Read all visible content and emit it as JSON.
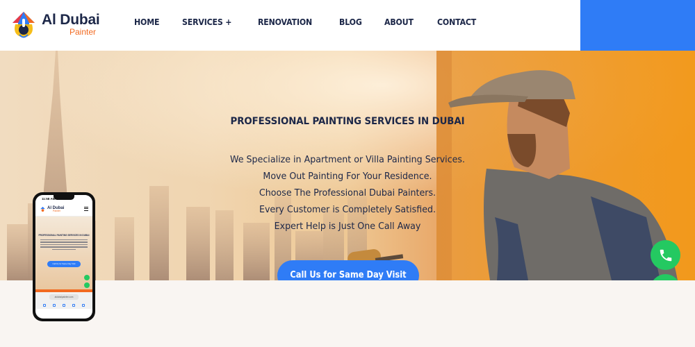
{
  "brand": {
    "name": "Al Dubai",
    "tagline": "Painter"
  },
  "nav": {
    "items": [
      "HOME",
      "SERVICES +",
      "RENOVATION",
      "BLOG",
      "ABOUT",
      "CONTACT"
    ]
  },
  "hero": {
    "title": "PROFESSIONAL PAINTING SERVICES IN DUBAI",
    "lines": [
      "We Specialize in Apartment or Villa Painting Services.",
      "Move Out Painting For Your Residence.",
      "Choose The Professional Dubai Painters.",
      "Every Customer is Completely Satisfied.",
      "Expert Help is Just One Call Away"
    ],
    "cta_label": "Call Us for Same Day Visit"
  },
  "floating": {
    "phone_icon": "phone-icon",
    "whatsapp_icon": "whatsapp-icon"
  },
  "mockup": {
    "status_time": "11:58 AM",
    "brand_name": "Al Dubai",
    "brand_tagline": "Painter",
    "hero_title": "PROFESSIONAL PAINTING SERVICES IN DUBAI",
    "cta_label": "Call Us for Same Day Visit",
    "url": "aldubaipainter.com"
  },
  "colors": {
    "primary_blue": "#2f7cf6",
    "navy": "#1c2748",
    "brand_orange": "#f26a21",
    "whatsapp_green": "#24c961",
    "lower_background": "#f9f5f2"
  }
}
